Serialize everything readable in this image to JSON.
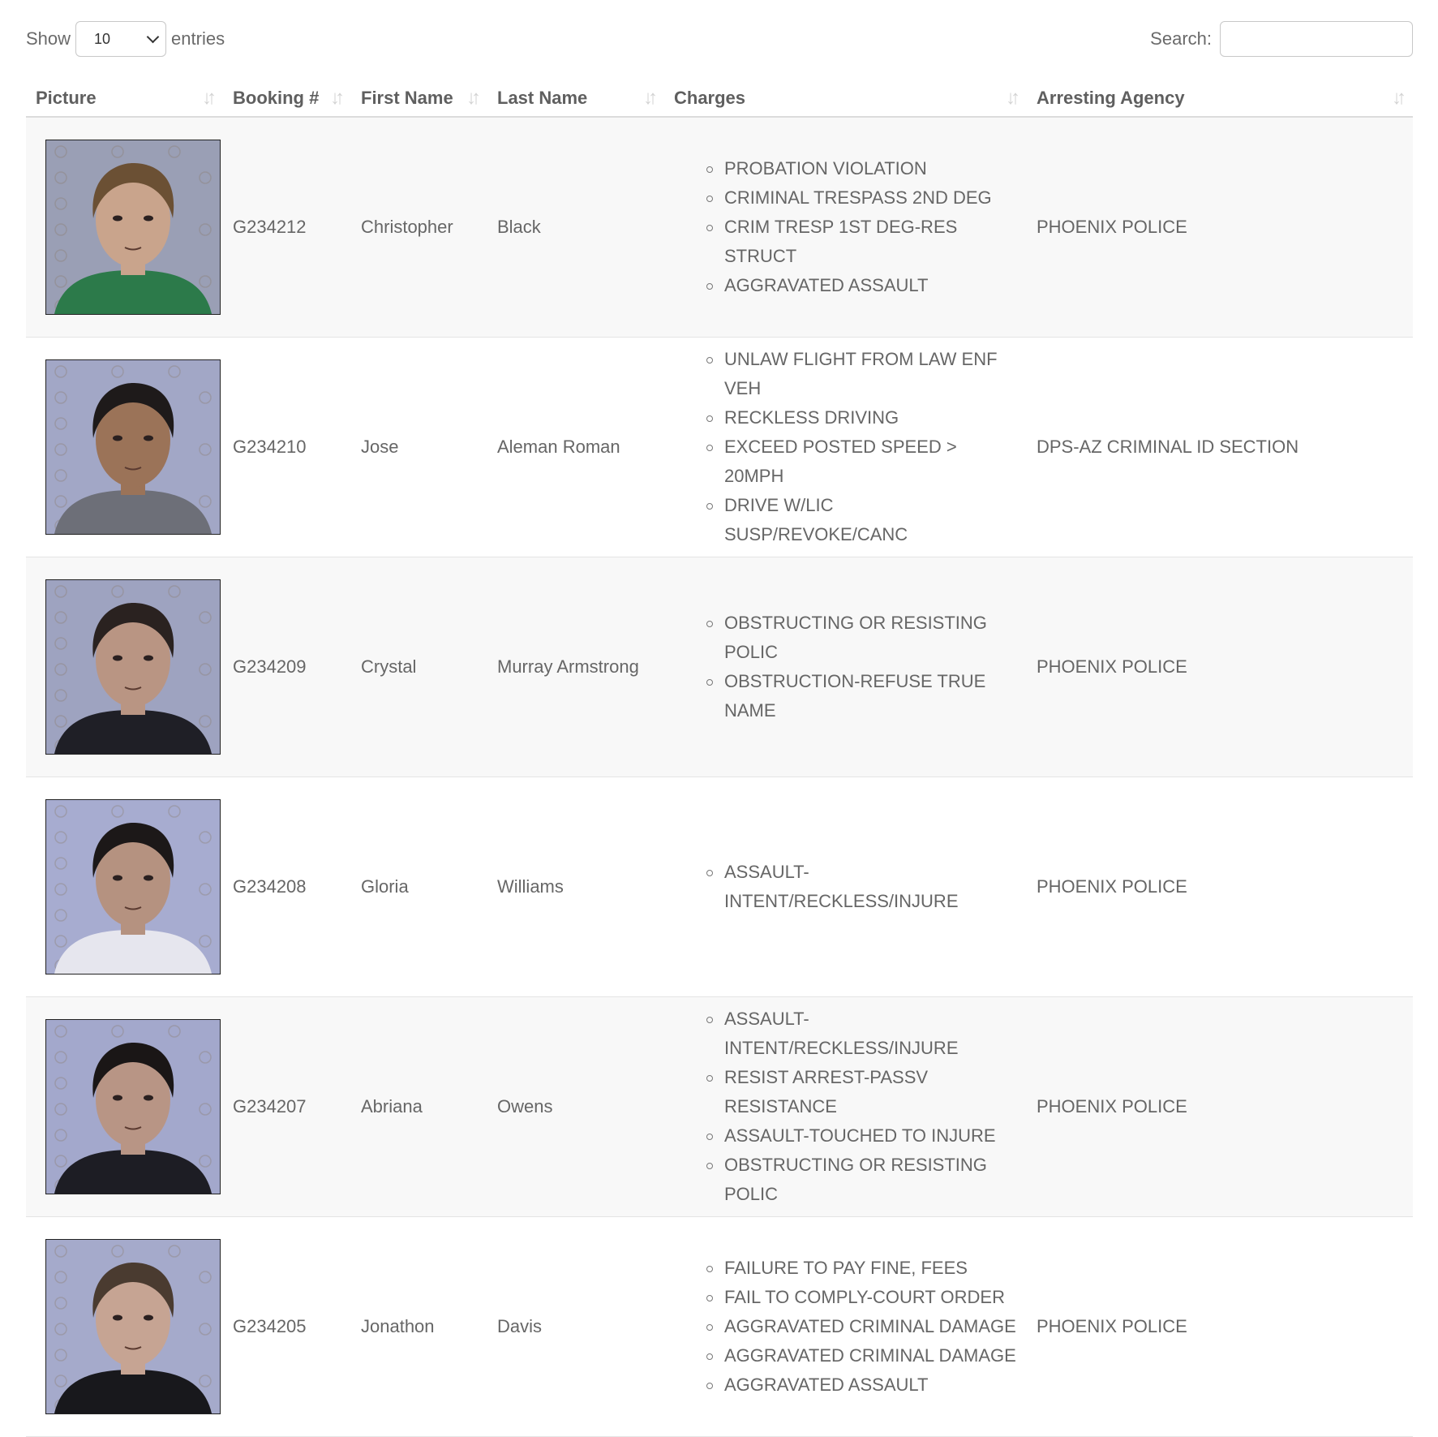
{
  "controls": {
    "show_label": "Show",
    "entries_value": "10",
    "entries_label": "entries",
    "search_label": "Search:",
    "search_value": ""
  },
  "columns": [
    "Picture",
    "Booking #",
    "First Name",
    "Last Name",
    "Charges",
    "Arresting Agency"
  ],
  "rows": [
    {
      "booking": "G234212",
      "first": "Christopher",
      "last": "Black",
      "charges": [
        "PROBATION VIOLATION",
        "CRIMINAL TRESPASS 2ND DEG",
        "CRIM TRESP 1ST DEG-RES STRUCT",
        "AGGRAVATED ASSAULT"
      ],
      "agency": "PHOENIX POLICE",
      "photo": {
        "bg": "#9a9fb5",
        "shirt": "#2c7a4a",
        "skin": "#c9a48c",
        "hair": "#6b5034"
      }
    },
    {
      "booking": "G234210",
      "first": "Jose",
      "last": "Aleman Roman",
      "charges": [
        "UNLAW FLIGHT FROM LAW ENF VEH",
        "RECKLESS DRIVING",
        "EXCEED POSTED SPEED > 20MPH",
        "DRIVE W/LIC SUSP/REVOKE/CANC"
      ],
      "agency": "DPS-AZ CRIMINAL ID SECTION",
      "photo": {
        "bg": "#a2a7c6",
        "shirt": "#6d6f78",
        "skin": "#9b7358",
        "hair": "#1e1a1a"
      }
    },
    {
      "booking": "G234209",
      "first": "Crystal",
      "last": "Murray Armstrong",
      "charges": [
        "OBSTRUCTING OR RESISTING POLIC",
        "OBSTRUCTION-REFUSE TRUE NAME"
      ],
      "agency": "PHOENIX POLICE",
      "photo": {
        "bg": "#9ea3c0",
        "shirt": "#1f1f26",
        "skin": "#b99583",
        "hair": "#2a2220"
      }
    },
    {
      "booking": "G234208",
      "first": "Gloria",
      "last": "Williams",
      "charges": [
        "ASSAULT-INTENT/RECKLESS/INJURE"
      ],
      "agency": "PHOENIX POLICE",
      "photo": {
        "bg": "#a7acd0",
        "shirt": "#e6e6ee",
        "skin": "#b59280",
        "hair": "#1c1818"
      }
    },
    {
      "booking": "G234207",
      "first": "Abriana",
      "last": "Owens",
      "charges": [
        "ASSAULT-INTENT/RECKLESS/INJURE",
        "RESIST ARREST-PASSV RESISTANCE",
        "ASSAULT-TOUCHED TO INJURE",
        "OBSTRUCTING OR RESISTING POLIC"
      ],
      "agency": "PHOENIX POLICE",
      "photo": {
        "bg": "#a3a8cc",
        "shirt": "#1d1d24",
        "skin": "#b89585",
        "hair": "#1a1616"
      }
    },
    {
      "booking": "G234205",
      "first": "Jonathon",
      "last": "Davis",
      "charges": [
        "FAILURE TO PAY FINE, FEES",
        "FAIL TO COMPLY-COURT ORDER",
        "AGGRAVATED CRIMINAL DAMAGE",
        "AGGRAVATED CRIMINAL DAMAGE",
        "AGGRAVATED ASSAULT"
      ],
      "agency": "PHOENIX POLICE",
      "photo": {
        "bg": "#a5aacb",
        "shirt": "#18181c",
        "skin": "#c6a493",
        "hair": "#4a3b30"
      }
    }
  ]
}
